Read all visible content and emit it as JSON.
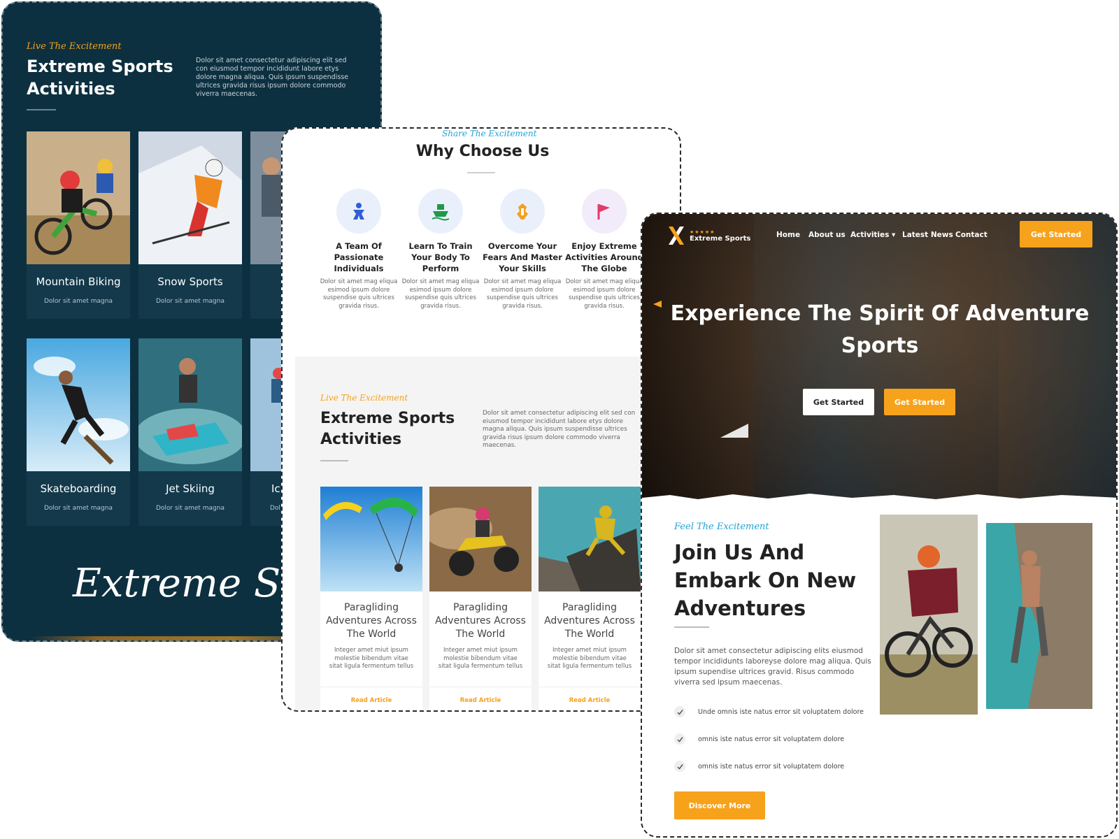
{
  "panel1": {
    "tagline": "Live The Excitement",
    "title": "Extreme Sports Activities",
    "description": "Dolor sit amet consectetur adipiscing elit sed con eiusmod tempor incididunt labore etys dolore magna aliqua. Quis ipsum suspendisse ultrices gravida risus ipsum dolore commodo viverra maecenas.",
    "cards": [
      {
        "name": "Mountain Biking",
        "sub": "Dolor sit amet magna"
      },
      {
        "name": "Snow Sports",
        "sub": "Dolor sit amet magna"
      },
      {
        "name": "",
        "sub": ""
      },
      {
        "name": "Skateboarding",
        "sub": "Dolor sit amet magna"
      },
      {
        "name": "Jet Skiing",
        "sub": "Dolor sit amet magna"
      },
      {
        "name": "Ic",
        "sub": "Dol"
      }
    ],
    "script_text": "Extreme Spor"
  },
  "panel2": {
    "tagline": "Share The Excitement",
    "title": "Why Choose Us",
    "features": [
      {
        "title": "A Team Of Passionate Individuals",
        "desc": "Dolor sit amet mag eliqua esimod ipsum dolore suspendise quis ultrices gravida risus.",
        "icon": "team-icon"
      },
      {
        "title": "Learn To Train Your Body To Perform",
        "desc": "Dolor sit amet mag eliqua esimod ipsum dolore suspendise quis ultrices gravida risus.",
        "icon": "boat-icon"
      },
      {
        "title": "Overcome Your Fears And Master Your Skills",
        "desc": "Dolor sit amet mag eliqua esimod ipsum dolore suspendise quis ultrices gravida risus.",
        "icon": "mask-icon"
      },
      {
        "title": "Enjoy Extreme Activities Around The Globe",
        "desc": "Dolor sit amet mag eliqua esimod ipsum dolore suspendise quis ultrices gravida risus.",
        "icon": "flag-icon"
      }
    ],
    "section_tagline": "Live The Excitement",
    "section_title": "Extreme Sports Activities",
    "section_desc": "Dolor sit amet consectetur adipiscing elit sed con eiusmod tempor incididunt labore etys dolore magna aliqua. Quis ipsum suspendisse ultrices gravida risus ipsum dolore commodo viverra maecenas.",
    "articles": [
      {
        "title": "Paragliding Adventures Across The World",
        "desc": "Integer amet miut ipsum molestie bibendum vitae sitat ligula fermentum tellus",
        "link": "Read Article"
      },
      {
        "title": "Paragliding Adventures Across The World",
        "desc": "Integer amet miut ipsum molestie bibendum vitae sitat ligula fermentum tellus",
        "link": "Read Article"
      },
      {
        "title": "Paragliding Adventures Across The World",
        "desc": "Integer amet miut ipsum molestie bibendum vitae sitat ligula fermentum tellus",
        "link": "Read Article"
      }
    ]
  },
  "panel3": {
    "logo_text": "Extreme Sports",
    "logo_stars": "★★★★★",
    "nav": [
      "Home",
      "About us",
      "Activities ▾",
      "Latest News",
      "Contact"
    ],
    "cta": "Get Started",
    "hero_title": "Experience The Spirit Of Adventure Sports",
    "hero_btn_primary": "Get Started",
    "hero_btn_secondary": "Get Started",
    "tagline": "Feel The Excitement",
    "title": "Join Us And Embark On New Adventures",
    "description": "Dolor sit amet consectetur adipiscing elits eiusmod tempor incididunts laboreyse dolore mag aliqua. Quis ipsum supendise ultrices gravid. Risus commodo viverra sed ipsum maecenas.",
    "checklist": [
      "Unde omnis iste natus error sit voluptatem dolore",
      "omnis iste natus error sit voluptatem dolore",
      "omnis iste natus error sit voluptatem dolore"
    ],
    "discover": "Discover More"
  },
  "colors": {
    "accent": "#f7a21b",
    "dark": "#0d3040",
    "blue": "#1fa4d6"
  }
}
